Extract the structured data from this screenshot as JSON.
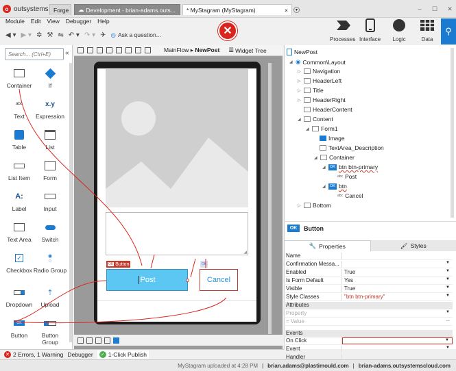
{
  "app": {
    "logo_text": "outsystems",
    "tabs": [
      {
        "label": "Forge"
      },
      {
        "label": "Development - brian-adams.outs..."
      },
      {
        "label": "* MyStagram (MyStagram)"
      }
    ],
    "tab_close": "×"
  },
  "menu": [
    "Module",
    "Edit",
    "View",
    "Debugger",
    "Help"
  ],
  "toolbar": {
    "ask_label": "Ask a question...",
    "tools": [
      {
        "label": "Processes"
      },
      {
        "label": "Interface"
      },
      {
        "label": "Logic"
      },
      {
        "label": "Data"
      }
    ]
  },
  "left": {
    "search_placeholder": "Search... (Ctrl+E)",
    "widgets": [
      {
        "label": "Container"
      },
      {
        "label": "If"
      },
      {
        "label": "Text",
        "icon_text": "abc"
      },
      {
        "label": "Expression",
        "icon_text": "x.y"
      },
      {
        "label": "Table"
      },
      {
        "label": "List"
      },
      {
        "label": "List Item"
      },
      {
        "label": "Form"
      },
      {
        "label": "Label",
        "icon_text": "A:"
      },
      {
        "label": "Input"
      },
      {
        "label": "Text Area"
      },
      {
        "label": "Switch"
      },
      {
        "label": "Checkbox"
      },
      {
        "label": "Radio Group"
      },
      {
        "label": "Dropdown"
      },
      {
        "label": "Upload"
      },
      {
        "label": "Button",
        "icon_text": "OK"
      },
      {
        "label": "Button Group"
      }
    ]
  },
  "canvas": {
    "breadcrumb_flow": "MainFlow",
    "breadcrumb_sep": "▸",
    "breadcrumb_page": "NewPost",
    "widget_tree_label": "Widget Tree",
    "button_tag": "Button",
    "button_tag_icon": "OK",
    "post_label": "Post",
    "cancel_label": "Cancel"
  },
  "tree": [
    {
      "label": "NewPost"
    },
    {
      "label": "Common\\Layout"
    },
    {
      "label": "Navigation"
    },
    {
      "label": "HeaderLeft"
    },
    {
      "label": "Title"
    },
    {
      "label": "HeaderRight"
    },
    {
      "label": "HeaderContent"
    },
    {
      "label": "Content"
    },
    {
      "label": "Form1"
    },
    {
      "label": "Image"
    },
    {
      "label": "TextArea_Description"
    },
    {
      "label": "Container"
    },
    {
      "label": "btn btn-primary",
      "icon_text": "OK"
    },
    {
      "label": "Post",
      "icon_text": "abc"
    },
    {
      "label": "btn",
      "icon_text": "OK"
    },
    {
      "label": "Cancel",
      "icon_text": "abc"
    },
    {
      "label": "Bottom"
    }
  ],
  "props": {
    "title": "Button",
    "title_icon": "OK",
    "tab_properties": "Properties",
    "tab_styles": "Styles",
    "rows": [
      {
        "key": "Name",
        "value": ""
      },
      {
        "key": "Confirmation Messa...",
        "value": ""
      },
      {
        "key": "Enabled",
        "value": "True"
      },
      {
        "key": "Is Form Default",
        "value": "Yes"
      },
      {
        "key": "Visible",
        "value": "True"
      },
      {
        "key": "Style Classes",
        "value": "\"btn btn-primary\""
      }
    ],
    "attributes_section": "Attributes",
    "property_placeholder": "Property",
    "value_placeholder": "Value",
    "value_prefix": "=",
    "events_section": "Events",
    "on_click": "On Click",
    "event": "Event",
    "handler": "Handler"
  },
  "status": {
    "errors": "2 Errors, 1 Warning",
    "debugger": "Debugger",
    "publish": "1-Click Publish",
    "error_icon": "✕",
    "publish_icon": "✓"
  },
  "footer": {
    "uploaded": "MyStagram uploaded at 4:28 PM",
    "user": "brian.adams@plastimould.com",
    "server": "brian-adams.outsystemscloud.com",
    "sep": "|"
  }
}
